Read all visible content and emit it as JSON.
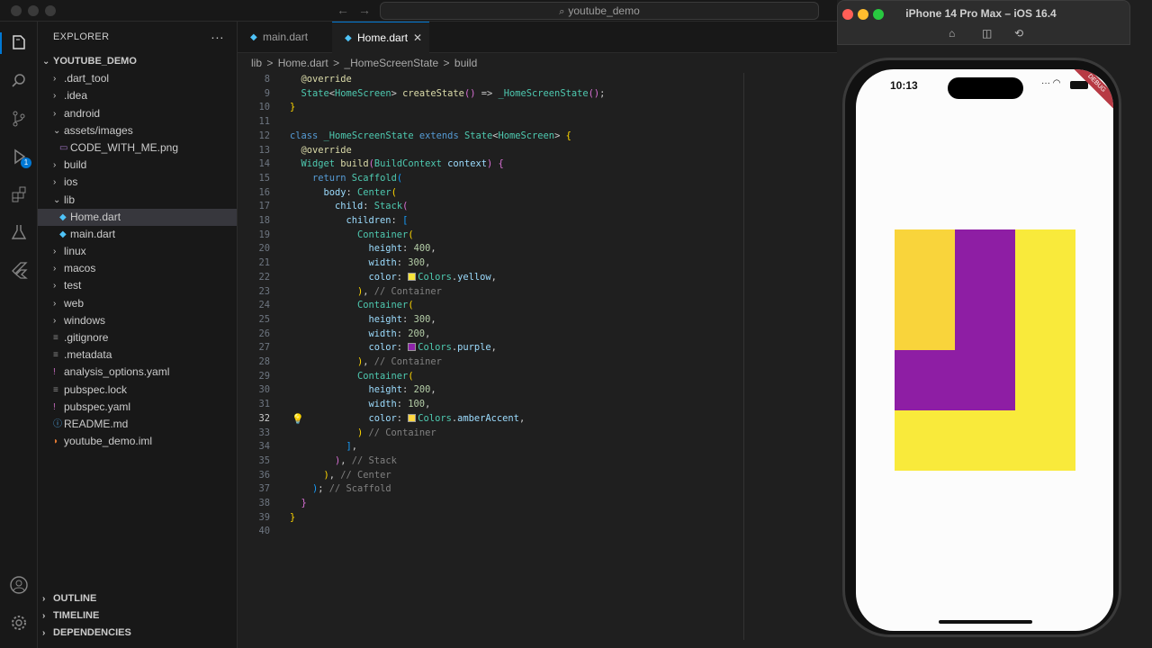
{
  "titlebar": {
    "search": "youtube_demo"
  },
  "sidebar": {
    "header": "EXPLORER",
    "root": "YOUTUBE_DEMO",
    "items": [
      {
        "label": ".dart_tool",
        "type": "folder",
        "depth": 1,
        "open": false
      },
      {
        "label": ".idea",
        "type": "folder",
        "depth": 1,
        "open": false
      },
      {
        "label": "android",
        "type": "folder",
        "depth": 1,
        "open": false
      },
      {
        "label": "assets/images",
        "type": "folder",
        "depth": 1,
        "open": true
      },
      {
        "label": "CODE_WITH_ME.png",
        "type": "image",
        "depth": 2
      },
      {
        "label": "build",
        "type": "folder",
        "depth": 1,
        "open": false
      },
      {
        "label": "ios",
        "type": "folder",
        "depth": 1,
        "open": false
      },
      {
        "label": "lib",
        "type": "folder",
        "depth": 1,
        "open": true
      },
      {
        "label": "Home.dart",
        "type": "dart",
        "depth": 2,
        "selected": true
      },
      {
        "label": "main.dart",
        "type": "dart",
        "depth": 2
      },
      {
        "label": "linux",
        "type": "folder",
        "depth": 1,
        "open": false
      },
      {
        "label": "macos",
        "type": "folder",
        "depth": 1,
        "open": false
      },
      {
        "label": "test",
        "type": "folder",
        "depth": 1,
        "open": false
      },
      {
        "label": "web",
        "type": "folder",
        "depth": 1,
        "open": false
      },
      {
        "label": "windows",
        "type": "folder",
        "depth": 1,
        "open": false
      },
      {
        "label": ".gitignore",
        "type": "config",
        "depth": 1
      },
      {
        "label": ".metadata",
        "type": "config",
        "depth": 1
      },
      {
        "label": "analysis_options.yaml",
        "type": "yaml",
        "depth": 1
      },
      {
        "label": "pubspec.lock",
        "type": "config",
        "depth": 1
      },
      {
        "label": "pubspec.yaml",
        "type": "yaml",
        "depth": 1
      },
      {
        "label": "README.md",
        "type": "info",
        "depth": 1
      },
      {
        "label": "youtube_demo.iml",
        "type": "rss",
        "depth": 1
      }
    ],
    "sections": [
      "OUTLINE",
      "TIMELINE",
      "DEPENDENCIES"
    ]
  },
  "tabs": [
    {
      "label": "main.dart",
      "active": false
    },
    {
      "label": "Home.dart",
      "active": true
    }
  ],
  "breadcrumb": [
    "lib",
    ">",
    "Home.dart",
    ">",
    "_HomeScreenState",
    ">",
    "build"
  ],
  "code": {
    "current_line": 32,
    "lines": [
      {
        "n": 8,
        "indent": 1,
        "segs": [
          [
            "an",
            "@override"
          ]
        ]
      },
      {
        "n": 9,
        "indent": 1,
        "segs": [
          [
            "ty",
            "State"
          ],
          [
            "pn",
            "<"
          ],
          [
            "ty",
            "HomeScreen"
          ],
          [
            "pn",
            "> "
          ],
          [
            "fn",
            "createState"
          ],
          [
            "br2",
            "()"
          ],
          [
            "pn",
            " => "
          ],
          [
            "ty",
            "_HomeScreenState"
          ],
          [
            "br2",
            "()"
          ],
          [
            "pn",
            ";"
          ]
        ]
      },
      {
        "n": 10,
        "indent": 0,
        "segs": [
          [
            "br1",
            "}"
          ]
        ]
      },
      {
        "n": 11,
        "indent": 0,
        "segs": []
      },
      {
        "n": 12,
        "indent": 0,
        "segs": [
          [
            "kw",
            "class "
          ],
          [
            "ty",
            "_HomeScreenState "
          ],
          [
            "kw",
            "extends "
          ],
          [
            "ty",
            "State"
          ],
          [
            "pn",
            "<"
          ],
          [
            "ty",
            "HomeScreen"
          ],
          [
            "pn",
            "> "
          ],
          [
            "br1",
            "{"
          ]
        ]
      },
      {
        "n": 13,
        "indent": 1,
        "segs": [
          [
            "an",
            "@override"
          ]
        ]
      },
      {
        "n": 14,
        "indent": 1,
        "segs": [
          [
            "ty",
            "Widget "
          ],
          [
            "fn",
            "build"
          ],
          [
            "br2",
            "("
          ],
          [
            "ty",
            "BuildContext "
          ],
          [
            "pr",
            "context"
          ],
          [
            "br2",
            ") {"
          ]
        ]
      },
      {
        "n": 15,
        "indent": 2,
        "segs": [
          [
            "kw",
            "return "
          ],
          [
            "ty",
            "Scaffold"
          ],
          [
            "br3",
            "("
          ]
        ]
      },
      {
        "n": 16,
        "indent": 3,
        "segs": [
          [
            "pr",
            "body"
          ],
          [
            "pn",
            ": "
          ],
          [
            "ty",
            "Center"
          ],
          [
            "br1",
            "("
          ]
        ]
      },
      {
        "n": 17,
        "indent": 4,
        "segs": [
          [
            "pr",
            "child"
          ],
          [
            "pn",
            ": "
          ],
          [
            "ty",
            "Stack"
          ],
          [
            "br2",
            "("
          ]
        ]
      },
      {
        "n": 18,
        "indent": 5,
        "segs": [
          [
            "pr",
            "children"
          ],
          [
            "pn",
            ": "
          ],
          [
            "br3",
            "["
          ]
        ]
      },
      {
        "n": 19,
        "indent": 6,
        "segs": [
          [
            "ty",
            "Container"
          ],
          [
            "br1",
            "("
          ]
        ]
      },
      {
        "n": 20,
        "indent": 7,
        "segs": [
          [
            "pr",
            "height"
          ],
          [
            "pn",
            ": "
          ],
          [
            "nu",
            "400"
          ],
          [
            "pn",
            ","
          ]
        ]
      },
      {
        "n": 21,
        "indent": 7,
        "segs": [
          [
            "pr",
            "width"
          ],
          [
            "pn",
            ": "
          ],
          [
            "nu",
            "300"
          ],
          [
            "pn",
            ","
          ]
        ]
      },
      {
        "n": 22,
        "indent": 7,
        "segs": [
          [
            "pr",
            "color"
          ],
          [
            "pn",
            ": "
          ],
          [
            "sw",
            "#f7e43a"
          ],
          [
            "ty",
            "Colors"
          ],
          [
            "pn",
            "."
          ],
          [
            "pr",
            "yellow"
          ],
          [
            "pn",
            ","
          ]
        ]
      },
      {
        "n": 23,
        "indent": 6,
        "segs": [
          [
            "br1",
            ")"
          ],
          [
            "pn",
            ", "
          ],
          [
            "dk",
            "// Container"
          ]
        ]
      },
      {
        "n": 24,
        "indent": 6,
        "segs": [
          [
            "ty",
            "Container"
          ],
          [
            "br1",
            "("
          ]
        ]
      },
      {
        "n": 25,
        "indent": 7,
        "segs": [
          [
            "pr",
            "height"
          ],
          [
            "pn",
            ": "
          ],
          [
            "nu",
            "300"
          ],
          [
            "pn",
            ","
          ]
        ]
      },
      {
        "n": 26,
        "indent": 7,
        "segs": [
          [
            "pr",
            "width"
          ],
          [
            "pn",
            ": "
          ],
          [
            "nu",
            "200"
          ],
          [
            "pn",
            ","
          ]
        ]
      },
      {
        "n": 27,
        "indent": 7,
        "segs": [
          [
            "pr",
            "color"
          ],
          [
            "pn",
            ": "
          ],
          [
            "sw",
            "#8e24aa"
          ],
          [
            "ty",
            "Colors"
          ],
          [
            "pn",
            "."
          ],
          [
            "pr",
            "purple"
          ],
          [
            "pn",
            ","
          ]
        ]
      },
      {
        "n": 28,
        "indent": 6,
        "segs": [
          [
            "br1",
            ")"
          ],
          [
            "pn",
            ", "
          ],
          [
            "dk",
            "// Container"
          ]
        ]
      },
      {
        "n": 29,
        "indent": 6,
        "segs": [
          [
            "ty",
            "Container"
          ],
          [
            "br1",
            "("
          ]
        ]
      },
      {
        "n": 30,
        "indent": 7,
        "segs": [
          [
            "pr",
            "height"
          ],
          [
            "pn",
            ": "
          ],
          [
            "nu",
            "200"
          ],
          [
            "pn",
            ","
          ]
        ]
      },
      {
        "n": 31,
        "indent": 7,
        "segs": [
          [
            "pr",
            "width"
          ],
          [
            "pn",
            ": "
          ],
          [
            "nu",
            "100"
          ],
          [
            "pn",
            ","
          ]
        ]
      },
      {
        "n": 32,
        "indent": 7,
        "segs": [
          [
            "pr",
            "color"
          ],
          [
            "pn",
            ": "
          ],
          [
            "sw",
            "#ffd740"
          ],
          [
            "ty",
            "Colors"
          ],
          [
            "pn",
            "."
          ],
          [
            "pr",
            "amberAccent"
          ],
          [
            "pn",
            ","
          ]
        ]
      },
      {
        "n": 33,
        "indent": 6,
        "segs": [
          [
            "br1",
            ")"
          ],
          [
            "pn",
            " "
          ],
          [
            "dk",
            "// Container"
          ]
        ]
      },
      {
        "n": 34,
        "indent": 5,
        "segs": [
          [
            "br3",
            "]"
          ],
          [
            "pn",
            ","
          ]
        ]
      },
      {
        "n": 35,
        "indent": 4,
        "segs": [
          [
            "br2",
            ")"
          ],
          [
            "pn",
            ", "
          ],
          [
            "dk",
            "// Stack"
          ]
        ]
      },
      {
        "n": 36,
        "indent": 3,
        "segs": [
          [
            "br1",
            ")"
          ],
          [
            "pn",
            ", "
          ],
          [
            "dk",
            "// Center"
          ]
        ]
      },
      {
        "n": 37,
        "indent": 2,
        "segs": [
          [
            "br3",
            ")"
          ],
          [
            "pn",
            "; "
          ],
          [
            "dk",
            "// Scaffold"
          ]
        ]
      },
      {
        "n": 38,
        "indent": 1,
        "segs": [
          [
            "br2",
            "}"
          ]
        ]
      },
      {
        "n": 39,
        "indent": 0,
        "segs": [
          [
            "br1",
            "}"
          ]
        ]
      },
      {
        "n": 40,
        "indent": 0,
        "segs": []
      }
    ]
  },
  "simulator": {
    "title": "iPhone 14 Pro Max – iOS 16.4",
    "time": "10:13",
    "ribbon": "DEBUG",
    "stack": [
      {
        "name": "yellow",
        "height": 400,
        "width": 300,
        "color": "#f9ea3b"
      },
      {
        "name": "purple",
        "height": 300,
        "width": 200,
        "color": "#8e1ea4"
      },
      {
        "name": "amberAccent",
        "height": 200,
        "width": 100,
        "color": "#f9d43b"
      }
    ]
  }
}
